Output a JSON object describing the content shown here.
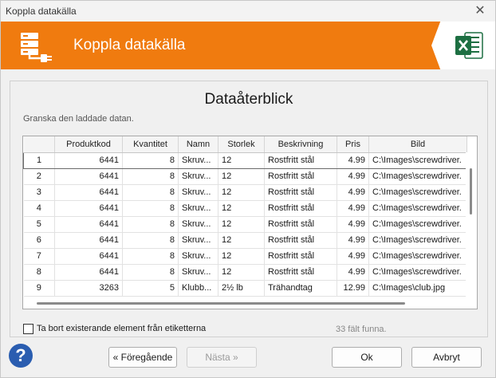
{
  "window": {
    "title": "Koppla datakälla"
  },
  "banner": {
    "heading": "Koppla datakälla",
    "icons": [
      "database-connect-icon",
      "excel-icon"
    ]
  },
  "panel": {
    "title": "Dataåterblick",
    "subtitle": "Granska den laddade datan."
  },
  "table": {
    "columns": [
      "",
      "Produktkod",
      "Kvantitet",
      "Namn",
      "Storlek",
      "Beskrivning",
      "Pris",
      "Bild"
    ],
    "rows": [
      [
        "1",
        "6441",
        "8",
        "Skruv...",
        "12",
        "Rostfritt stål",
        "4.99",
        "C:\\Images\\screwdriver."
      ],
      [
        "2",
        "6441",
        "8",
        "Skruv...",
        "12",
        "Rostfritt stål",
        "4.99",
        "C:\\Images\\screwdriver."
      ],
      [
        "3",
        "6441",
        "8",
        "Skruv...",
        "12",
        "Rostfritt stål",
        "4.99",
        "C:\\Images\\screwdriver."
      ],
      [
        "4",
        "6441",
        "8",
        "Skruv...",
        "12",
        "Rostfritt stål",
        "4.99",
        "C:\\Images\\screwdriver."
      ],
      [
        "5",
        "6441",
        "8",
        "Skruv...",
        "12",
        "Rostfritt stål",
        "4.99",
        "C:\\Images\\screwdriver."
      ],
      [
        "6",
        "6441",
        "8",
        "Skruv...",
        "12",
        "Rostfritt stål",
        "4.99",
        "C:\\Images\\screwdriver."
      ],
      [
        "7",
        "6441",
        "8",
        "Skruv...",
        "12",
        "Rostfritt stål",
        "4.99",
        "C:\\Images\\screwdriver."
      ],
      [
        "8",
        "6441",
        "8",
        "Skruv...",
        "12",
        "Rostfritt stål",
        "4.99",
        "C:\\Images\\screwdriver."
      ],
      [
        "9",
        "3263",
        "5",
        "Klubb...",
        "2½ lb",
        "Trähandtag",
        "12.99",
        "C:\\Images\\club.jpg"
      ]
    ]
  },
  "options": {
    "remove_existing_label": "Ta bort existerande element från etiketterna",
    "remove_existing_checked": false
  },
  "status": {
    "fields_found": "33 fält funna."
  },
  "buttons": {
    "previous": "« Föregående",
    "next": "Nästa »",
    "ok": "Ok",
    "cancel": "Avbryt"
  },
  "colors": {
    "banner": "#f07b0f",
    "excel_green": "#1d6f42",
    "help_blue": "#2a5db0"
  }
}
